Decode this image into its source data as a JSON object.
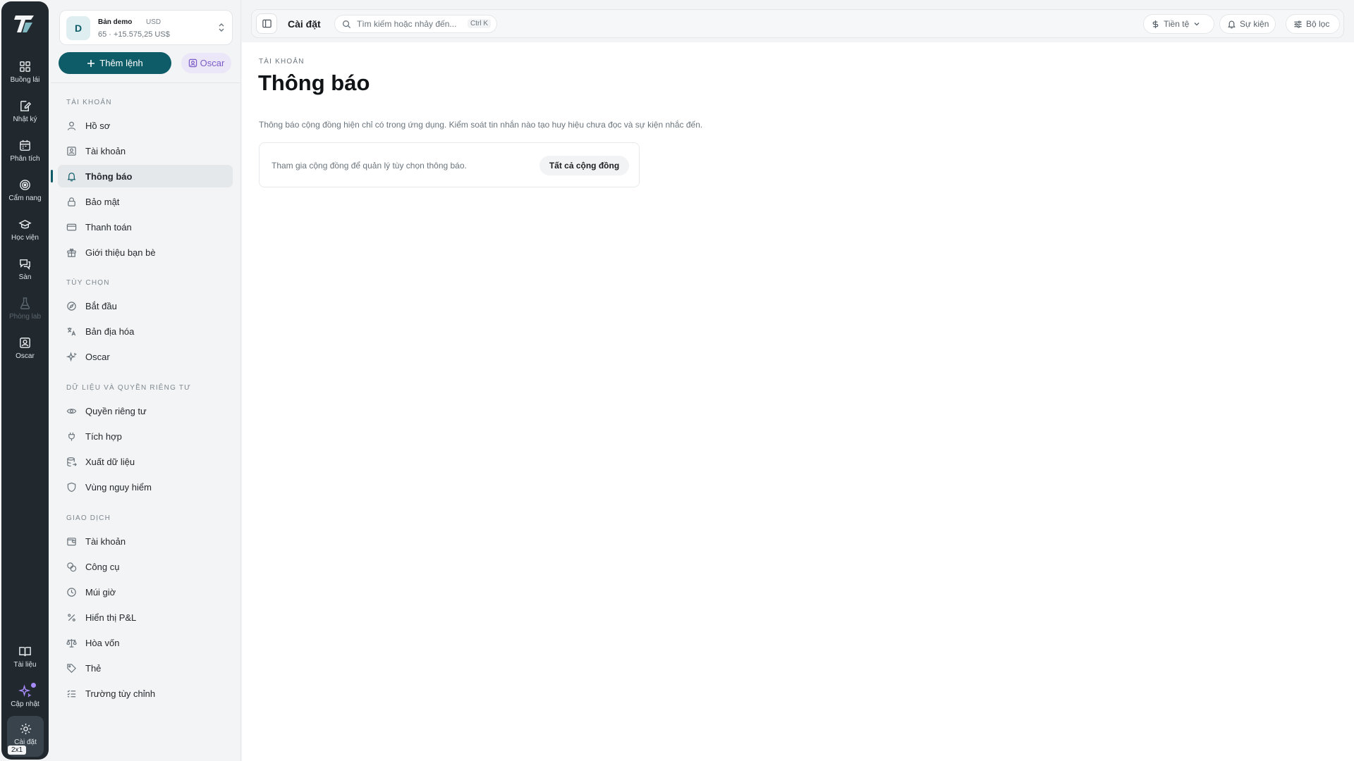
{
  "rail": {
    "items": [
      {
        "label": "Buồng lái",
        "icon": "dashboard-icon"
      },
      {
        "label": "Nhật ký",
        "icon": "journal-icon"
      },
      {
        "label": "Phân tích",
        "icon": "calendar-icon"
      },
      {
        "label": "Cẩm nang",
        "icon": "target-icon"
      },
      {
        "label": "Học viện",
        "icon": "graduation-cap-icon"
      },
      {
        "label": "Sàn",
        "icon": "chat-icon"
      },
      {
        "label": "Phòng lab",
        "icon": "flask-icon"
      },
      {
        "label": "Oscar",
        "icon": "oscar-icon"
      }
    ],
    "bottom": [
      {
        "label": "Tài liệu",
        "icon": "book-icon"
      },
      {
        "label": "Cập nhật",
        "icon": "sparkle-icon"
      },
      {
        "label": "Cài đặt",
        "icon": "gear-icon"
      }
    ],
    "badge": "2x1"
  },
  "account": {
    "avatar": "D",
    "name": "Bản demo",
    "currency": "USD",
    "balance": "65 · +15.575,25 US$"
  },
  "sidebar": {
    "add_label": "Thêm lệnh",
    "oscar_label": "Oscar",
    "sections": [
      {
        "title": "Tài khoản",
        "items": [
          "Hồ sơ",
          "Tài khoản",
          "Thông báo",
          "Bảo mật",
          "Thanh toán",
          "Giới thiệu bạn bè"
        ]
      },
      {
        "title": "Tùy chọn",
        "items": [
          "Bắt đầu",
          "Bản địa hóa",
          "Oscar"
        ]
      },
      {
        "title": "Dữ liệu và quyền riêng tư",
        "items": [
          "Quyền riêng tư",
          "Tích hợp",
          "Xuất dữ liệu",
          "Vùng nguy hiểm"
        ]
      },
      {
        "title": "Giao dịch",
        "items": [
          "Tài khoản",
          "Công cụ",
          "Múi giờ",
          "Hiển thị P&L",
          "Hòa vốn",
          "Thẻ",
          "Trường tùy chỉnh"
        ]
      }
    ],
    "active": "Thông báo"
  },
  "topbar": {
    "title": "Cài đặt",
    "search_placeholder": "Tìm kiếm hoặc nhảy đến...",
    "search_shortcut": "Ctrl K",
    "currency_label": "Tiền tệ",
    "events_label": "Sự kiện",
    "filter_label": "Bộ lọc"
  },
  "main": {
    "breadcrumb": "TÀI KHOẢN",
    "title": "Thông báo",
    "description": "Thông báo cộng đồng hiện chỉ có trong ứng dụng. Kiểm soát tin nhắn nào tạo huy hiệu chưa đọc và sự kiện nhắc đến.",
    "notice_text": "Tham gia cộng đồng để quản lý tùy chọn thông báo.",
    "notice_button": "Tất cả cộng đồng"
  },
  "colors": {
    "accent": "#0e5c68",
    "rail_bg": "#21282e",
    "oscar": "#7b5cc7"
  }
}
